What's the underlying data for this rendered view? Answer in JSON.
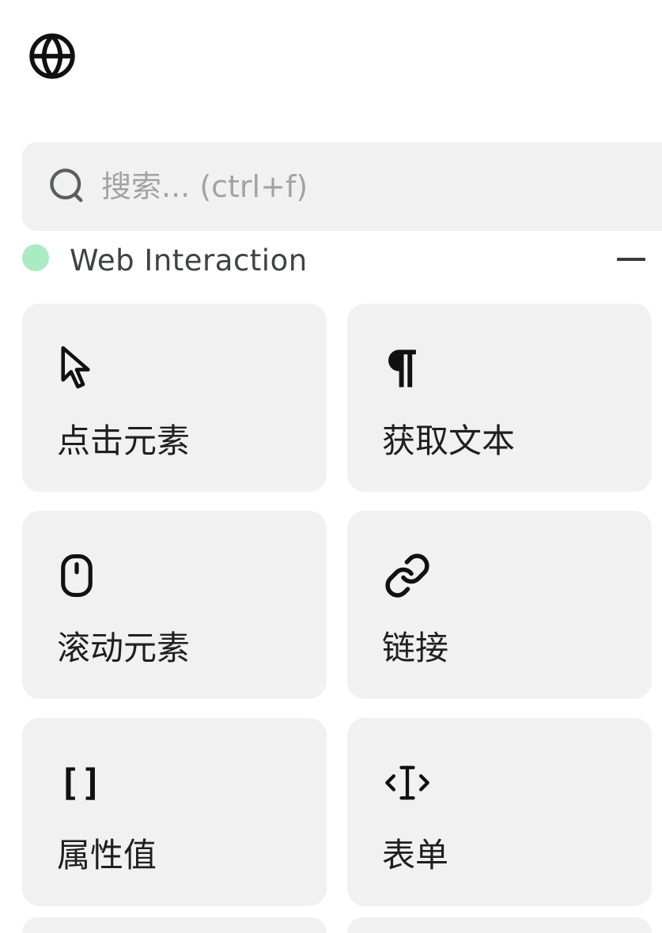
{
  "search": {
    "placeholder": "搜索... (ctrl+f)"
  },
  "section": {
    "title": "Web Interaction",
    "dot_color": "#a9ebc3"
  },
  "cards": [
    {
      "label": "点击元素",
      "icon": "cursor-icon"
    },
    {
      "label": "获取文本",
      "icon": "pilcrow-icon"
    },
    {
      "label": "滚动元素",
      "icon": "mouse-icon"
    },
    {
      "label": "链接",
      "icon": "link-icon"
    },
    {
      "label": "属性值",
      "icon": "brackets-icon",
      "icon_text": "[]"
    },
    {
      "label": "表单",
      "icon": "text-cursor-input-icon"
    }
  ],
  "colors": {
    "card_bg": "#f1f1f1",
    "placeholder": "#a3a3a3"
  }
}
